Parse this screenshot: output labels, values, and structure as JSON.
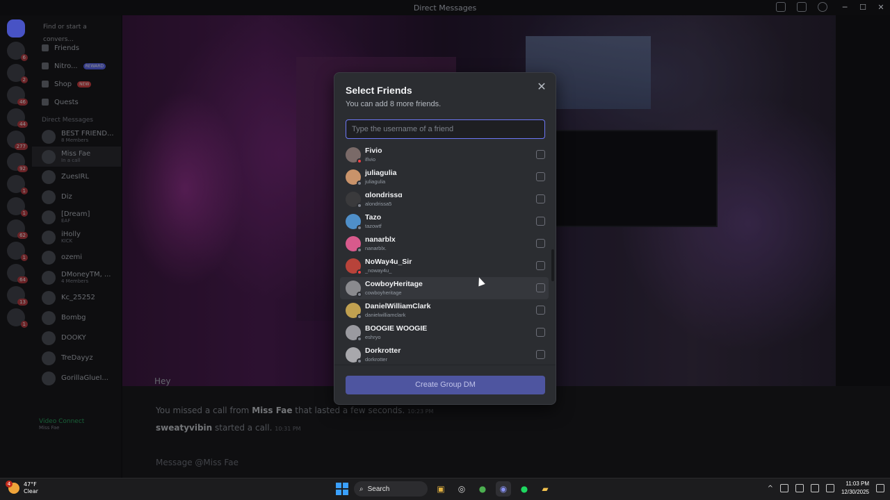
{
  "window": {
    "title": "Direct Messages"
  },
  "sidebar": {
    "search_placeholder": "Find or start a convers...",
    "nav": [
      {
        "label": "Friends"
      },
      {
        "label": "Nitro...",
        "badge": "REWARD"
      },
      {
        "label": "Shop",
        "badge": "NEW"
      },
      {
        "label": "Quests"
      }
    ],
    "dm_header": "Direct Messages",
    "dms": [
      {
        "name": "BEST FRIEND...",
        "sub": "8 Members"
      },
      {
        "name": "Miss Fae",
        "sub": "In a call"
      },
      {
        "name": "ZuesIRL",
        "sub": ""
      },
      {
        "name": "Diz",
        "sub": ""
      },
      {
        "name": "[Dream]",
        "sub": "EAF"
      },
      {
        "name": "iHolly",
        "sub": "KICK"
      },
      {
        "name": "ozemi",
        "sub": ""
      },
      {
        "name": "DMoneyTM, ...",
        "sub": "4 Members"
      },
      {
        "name": "Kc_25252",
        "sub": ""
      },
      {
        "name": "Bombg",
        "sub": ""
      },
      {
        "name": "DOOKY",
        "sub": ""
      },
      {
        "name": "TreDayyz",
        "sub": ""
      },
      {
        "name": "GorillaGlueI...",
        "sub": ""
      }
    ],
    "call_status": "Video Connect",
    "call_target": "Miss Fae"
  },
  "guild_badges": [
    "6",
    "2",
    "46",
    "44",
    "277",
    "92",
    "1",
    "1",
    "62",
    "1",
    "64",
    "13",
    "1"
  ],
  "chat": {
    "partial_line": "Hey",
    "line1": {
      "prefix": "You missed a call from",
      "name": "Miss Fae",
      "suffix": "that lasted a few seconds.",
      "time": "10:23 PM"
    },
    "line2": {
      "name": "sweatyvibin",
      "suffix": "started a call.",
      "time": "10:31 PM"
    },
    "message_placeholder": "Message @Miss Fae"
  },
  "modal": {
    "title": "Select Friends",
    "subtitle": "You can add 8 more friends.",
    "search_placeholder": "Type the username of a friend",
    "friends": [
      {
        "name": "Fivio",
        "username": "ifivio",
        "color": "#7a6a68",
        "status": "dnd"
      },
      {
        "name": "juliagulia",
        "username": "juliagulia",
        "color": "#c9936a",
        "status": "offline"
      },
      {
        "name": "ɑlondrissɑ",
        "username": "alondrissa5",
        "color": "#3a3a3c",
        "status": "offline"
      },
      {
        "name": "Tazo",
        "username": "tazowtf",
        "color": "#4f8fc9",
        "status": "offline"
      },
      {
        "name": "nanarblx",
        "username": "nanarblx.",
        "color": "#d85a8c",
        "status": "offline"
      },
      {
        "name": "NoWay4u_Sir",
        "username": "_noway4u_",
        "color": "#b8433a",
        "status": "dnd"
      },
      {
        "name": "CowboyHeritage",
        "username": "cowboyheritage",
        "color": "#8a8a8e",
        "status": "offline"
      },
      {
        "name": "DanielWilliamClark",
        "username": "danielwilliamclark",
        "color": "#c0a050",
        "status": "offline"
      },
      {
        "name": "BOOGIE WOOGIE",
        "username": "eshryo",
        "color": "#9a9aa0",
        "status": "offline"
      },
      {
        "name": "Dorkrotter",
        "username": "dorkrotter",
        "color": "#a8a8ac",
        "status": "offline"
      }
    ],
    "create_label": "Create Group DM"
  },
  "taskbar": {
    "weather_temp": "47°F",
    "weather_desc": "Clear",
    "weather_badge": "4",
    "search_label": "Search",
    "time": "11:03 PM",
    "date": "12/30/2025"
  }
}
